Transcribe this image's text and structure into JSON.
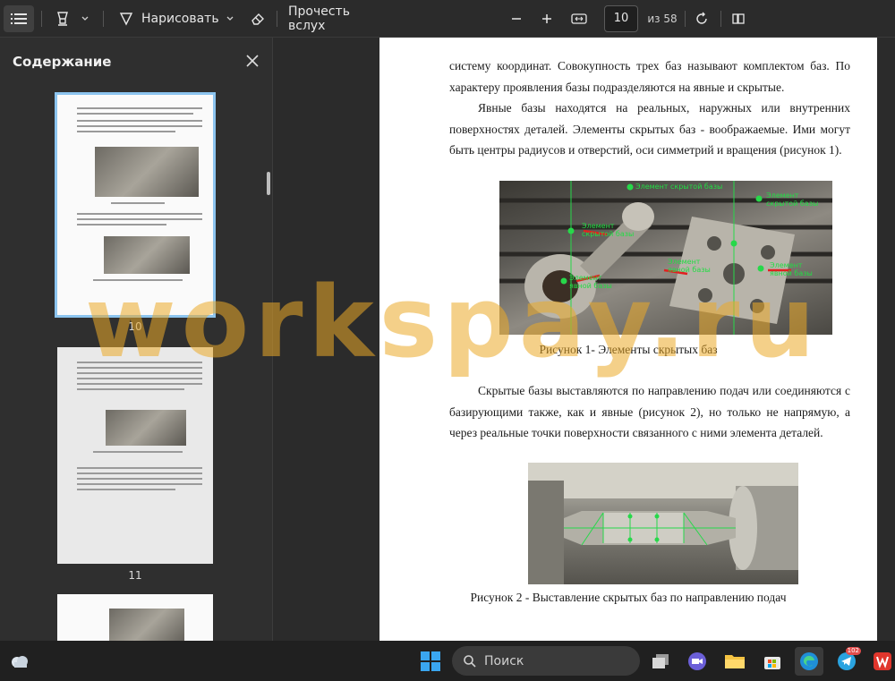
{
  "toolbar": {
    "draw_label": "Нарисовать",
    "read_aloud_label": "Прочесть вслух",
    "page_current": "10",
    "page_total": "из 58"
  },
  "sidebar": {
    "title": "Содержание",
    "thumbnails": [
      {
        "number": "10",
        "selected": true
      },
      {
        "number": "11",
        "selected": false
      }
    ]
  },
  "document": {
    "paragraphs": [
      "системy координат. Совокупность трех баз называют комплектом баз. По характеру проявления базы подразделяются на явные и скрытые.",
      "Явные базы находятся на реальных, наружных или внутренних поверхностях деталей. Элементы скрытых баз - воображаемые. Ими могут быть центры радиусов и отверстий, оси симметрий и вращения (рисунок 1).",
      "Скрытые базы выставляются по направлению подач или соединяются с базирующими также, как и явные (рисунок 2), но только не напрямую, а через реальные точки поверхности связанного с ними элемента деталей."
    ],
    "figure1": {
      "caption": "Рисунок 1- Элементы скрытых баз",
      "labels": [
        "Элемент скрытой базы",
        "Элемент скрытой базы",
        "Элемент скрытой базы",
        "Элемент явной базы",
        "Элемент явной базы",
        "Элемент явной базы"
      ]
    },
    "figure2": {
      "caption": "Рисунок 2 - Выставление скрытых баз по направлению подач"
    }
  },
  "watermark": "workspay.ru",
  "taskbar": {
    "search_label": "Поиск",
    "telegram_badge": "102"
  }
}
